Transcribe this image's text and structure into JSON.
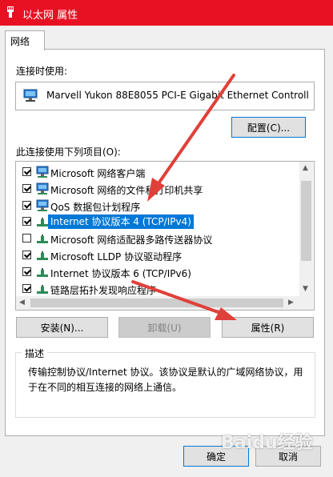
{
  "window": {
    "title": "以太网 属性"
  },
  "tabs": [
    {
      "label": "网络"
    }
  ],
  "connect_using": {
    "label": "连接时使用:",
    "adapter": "Marvell Yukon 88E8055 PCI-E Gigabit Ethernet Controll",
    "configure_label": "配置(C)..."
  },
  "items_section": {
    "label": "此连接使用下列项目(O):",
    "items": [
      {
        "label": "Microsoft 网络客户端",
        "checked": true,
        "icon": "network-client-icon"
      },
      {
        "label": "Microsoft 网络的文件和打印机共享",
        "checked": true,
        "icon": "file-printer-share-icon"
      },
      {
        "label": "QoS 数据包计划程序",
        "checked": true,
        "icon": "qos-icon"
      },
      {
        "label": "Internet 协议版本 4 (TCP/IPv4)",
        "checked": true,
        "icon": "protocol-icon",
        "selected": true
      },
      {
        "label": "Microsoft 网络适配器多路传送器协议",
        "checked": false,
        "icon": "protocol-icon"
      },
      {
        "label": "Microsoft LLDP 协议驱动程序",
        "checked": true,
        "icon": "protocol-icon"
      },
      {
        "label": "Internet 协议版本 6 (TCP/IPv6)",
        "checked": true,
        "icon": "protocol-icon"
      },
      {
        "label": "链路层拓扑发现响应程序",
        "checked": true,
        "icon": "protocol-icon"
      }
    ]
  },
  "buttons": {
    "install": "安装(N)...",
    "uninstall": "卸载(U)",
    "properties": "属性(R)",
    "ok": "确定",
    "cancel": "取消"
  },
  "description": {
    "label": "描述",
    "text": "传输控制协议/Internet 协议。该协议是默认的广域网络协议，用于在不同的相互连接的网络上通信。"
  },
  "watermark": "Baidu经验",
  "colors": {
    "titlebar": "#e81123",
    "selection": "#0078d7",
    "annotation": "#e0403a"
  }
}
